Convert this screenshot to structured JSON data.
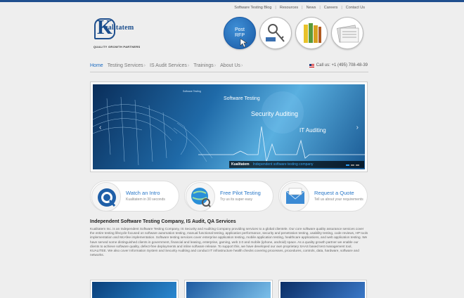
{
  "top_links": [
    "Software Testing Blog",
    "Resources",
    "News",
    "Careers",
    "Contact Us"
  ],
  "logo": {
    "letter": "K",
    "name": "ualitatem",
    "tagline": "QUALITY GROWTH PARTNERS"
  },
  "rfp": {
    "line1": "Post",
    "line2": "RFP"
  },
  "nav": [
    {
      "label": "Home"
    },
    {
      "label": "Testing Services"
    },
    {
      "label": "IS Audit Services"
    },
    {
      "label": "Trainings"
    },
    {
      "label": "About Us"
    }
  ],
  "call": "Call us: +1 (495) 708-48-39",
  "banner": {
    "small": "Software Testing",
    "software_testing": "Software Testing",
    "security_auditing": "Security Auditing",
    "it_auditing": "IT Auditing",
    "caption_brand": "Kualitatem",
    "caption_text": "Independent software testing company"
  },
  "cta": [
    {
      "title": "Watch an Intro",
      "sub": "Kualitatem in 30 seconds"
    },
    {
      "title": "Free Pilot Testing",
      "sub": "Try us its super easy"
    },
    {
      "title": "Request a Quote",
      "sub": "Tell us about your requirements"
    }
  ],
  "heading": "Independent Software Testing Company, IS Audit, QA Services",
  "paragraph": "Kualitatem Inc. is an Independent Software Testing Company, IS Security and Auditing Company providing services to a global clientele. Our core software quality assurance services cover the entire testing lifecycle focused on software automation testing, manual functional testing, application performance, security and penetration testing, usability testing, code reviews, HP tools implementation and McAfee implementation. Software testing services cover enterprise application testing, mobile application testing, healthcare applications, and web application testing. We have served some distinguished clients in government, financial and leasing, enterprise, gaming, web 2.0 and mobile (iphone, android) space. As a quality growth partner we enable our clients to achieve software quality, defect-free deployments and inline software release. To support this, we have developed our own proprietary SAAS based test management tool, KUALITEE. We also cover Information System and Security Auditing and conduct IT infrastructure health checks covering processes, procedures, controls, data, hardware, software and networks."
}
